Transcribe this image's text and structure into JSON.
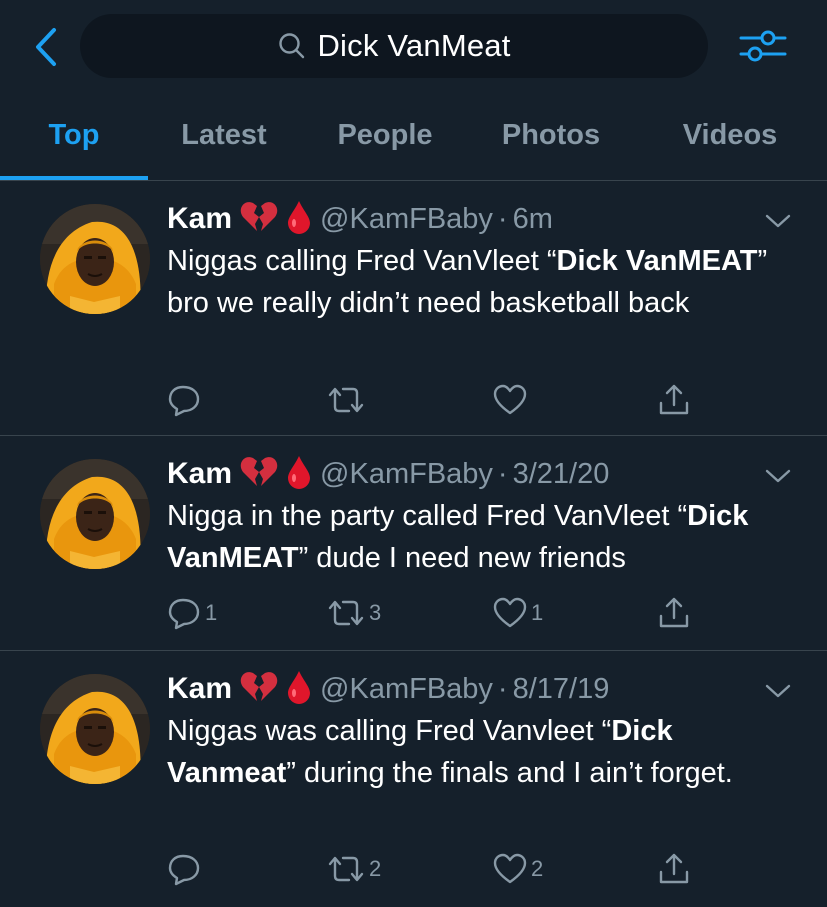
{
  "search": {
    "query": "Dick VanMeat"
  },
  "tabs": [
    {
      "label": "Top",
      "active": true
    },
    {
      "label": "Latest"
    },
    {
      "label": "People"
    },
    {
      "label": "Photos"
    },
    {
      "label": "Videos"
    }
  ],
  "colors": {
    "background": "#15202b",
    "accent": "#1da1f2",
    "muted": "#8899a6",
    "divider": "#38444d"
  },
  "tweets": [
    {
      "name": "Kam",
      "handle": "@KamFBaby",
      "time": "6m",
      "text_parts": [
        "Niggas calling Fred VanVleet “",
        "Dick VanMEAT",
        "” bro we really didn’t need basketball back"
      ],
      "replies": "",
      "retweets": "",
      "likes": ""
    },
    {
      "name": "Kam",
      "handle": "@KamFBaby",
      "time": "3/21/20",
      "text_parts": [
        "Nigga in the party called Fred VanVleet “",
        "Dick VanMEAT",
        "” dude I need new friends"
      ],
      "replies": "1",
      "retweets": "3",
      "likes": "1"
    },
    {
      "name": "Kam",
      "handle": "@KamFBaby",
      "time": "8/17/19",
      "text_parts": [
        "Niggas was calling Fred Vanvleet “",
        "Dick Vanmeat",
        "” during the finals and I ain’t forget."
      ],
      "replies": "",
      "retweets": "2",
      "likes": "2"
    }
  ],
  "separator": "·",
  "icons": {
    "back": "chevron-left-icon",
    "search": "search-icon",
    "filter": "filter-sliders-icon",
    "more": "chevron-down-icon",
    "reply": "reply-icon",
    "retweet": "retweet-icon",
    "like": "heart-icon",
    "share": "share-icon",
    "emoji_1": "broken-heart-emoji",
    "emoji_2": "drop-of-blood-emoji"
  }
}
